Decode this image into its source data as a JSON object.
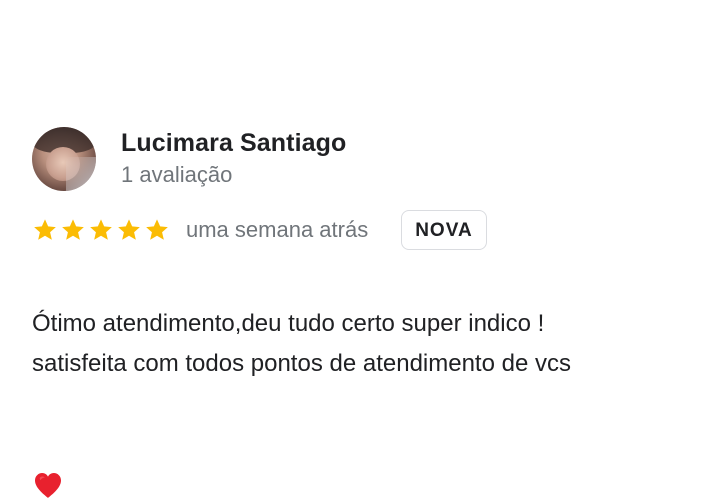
{
  "review": {
    "author_name": "Lucimara Santiago",
    "review_count": "1 avaliação",
    "rating": 5,
    "rating_max": 5,
    "time_ago": "uma semana atrás",
    "badge": "NOVA",
    "text": "Ótimo atendimento,deu tudo certo super indico !\nsatisfeita com todos pontos de atendimento de vcs",
    "emoji": "heart-icon",
    "colors": {
      "star": "#fbbc04",
      "heart": "#e8212e",
      "secondary_text": "#70757a"
    }
  }
}
